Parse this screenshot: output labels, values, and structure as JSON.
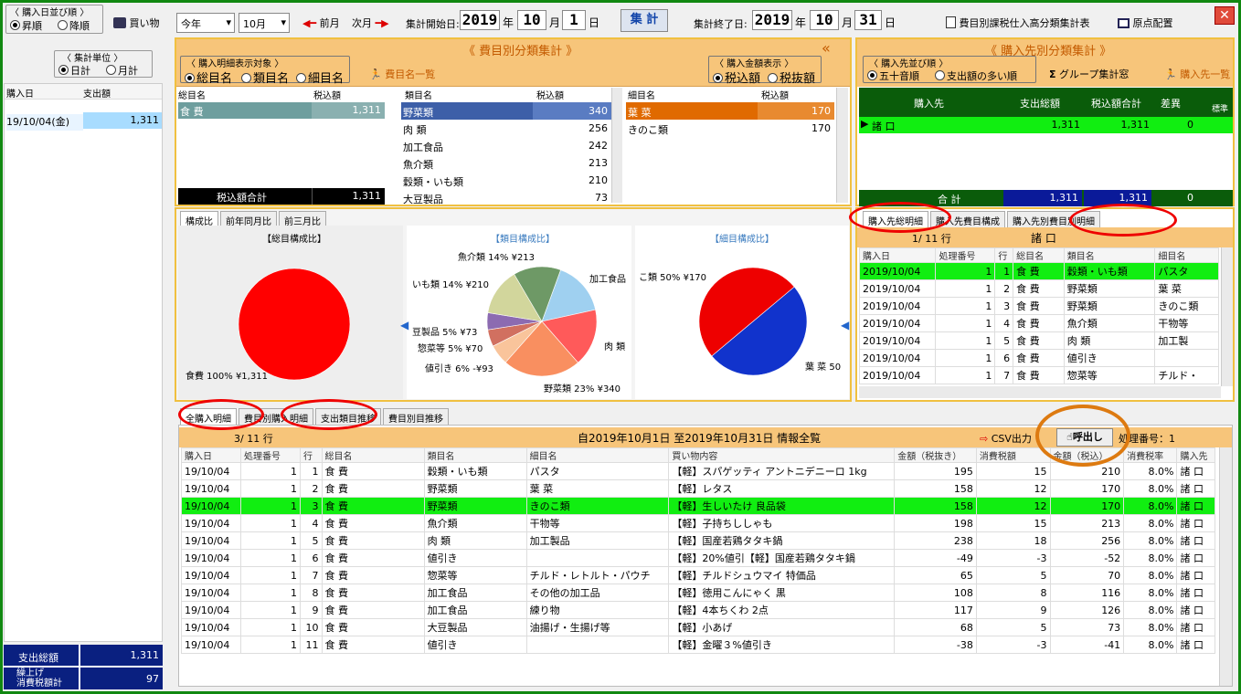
{
  "top": {
    "sort_group": "〈 購入日並び順 〉",
    "asc": "昇順",
    "desc": "降順",
    "shopping": "買い物",
    "year_sel": "今年",
    "month_sel": "10月",
    "prev": "前月",
    "next": "次月",
    "start_label": "集計開始日:",
    "start_y": "2019",
    "start_m": "10",
    "start_d": "1",
    "year_u": "年",
    "month_u": "月",
    "day_u": "日",
    "calc": "集 計",
    "end_label": "集計終了日:",
    "end_y": "2019",
    "end_m": "10",
    "end_d": "31",
    "report_btn": "費目別課税仕入高分類集計表",
    "gensetsu": "原点配置",
    "close": "✕"
  },
  "left": {
    "unit_group": "〈 集計単位 〉",
    "daily": "日計",
    "monthly": "月計",
    "col_date": "購入日",
    "col_amount": "支出額",
    "rows": [
      {
        "date": "19/10/04(金)",
        "amount": "1,311"
      }
    ],
    "total_label": "支出総額",
    "total_value": "1,311",
    "tax_label1": "繰上げ",
    "tax_label2": "消費税額計",
    "tax_value": "97"
  },
  "himoku": {
    "title": "《 費目別分類集計 》",
    "target_group": "〈 購入明細表示対象 〉",
    "opt1": "総目名",
    "opt2": "類目名",
    "opt3": "細目名",
    "list_btn": "費目名一覧",
    "amt_group": "〈 購入金額表示 〉",
    "incl": "税込額",
    "excl": "税抜額",
    "col_sou": "総目名",
    "col_tax": "税込額",
    "col_rui": "類目名",
    "col_sai": "細目名",
    "sou_rows": [
      {
        "name": "食 費",
        "value": "1,311"
      }
    ],
    "sou_total_label": "税込額合計",
    "sou_total": "1,311",
    "rui_rows": [
      {
        "name": "野菜類",
        "value": "340"
      },
      {
        "name": "肉 類",
        "value": "256"
      },
      {
        "name": "加工食品",
        "value": "242"
      },
      {
        "name": "魚介類",
        "value": "213"
      },
      {
        "name": "穀類・いも類",
        "value": "210"
      },
      {
        "name": "大豆製品",
        "value": "73"
      }
    ],
    "sai_rows": [
      {
        "name": "葉 菜",
        "value": "170"
      },
      {
        "name": "きのこ類",
        "value": "170"
      }
    ]
  },
  "pie": {
    "tabs": [
      "構成比",
      "前年同月比",
      "前三月比"
    ],
    "sou_title": "【総目構成比】",
    "rui_title": "【類目構成比】",
    "sai_title": "【細目構成比】",
    "sou_label": "食費 100% ¥1,311",
    "rui_labels": [
      "魚介類 14% ¥213",
      "加工食品",
      "肉 類",
      "野菜類 23% ¥340",
      "値引き 6% -¥93",
      "惣菜等 5% ¥70",
      "豆製品 5% ¥73",
      "いも類 14% ¥210"
    ],
    "sai_labels": [
      "こ類 50% ¥170",
      "葉 菜 50"
    ]
  },
  "chart_data": [
    {
      "type": "pie",
      "title": "【総目構成比】",
      "categories": [
        "食費"
      ],
      "values": [
        100
      ],
      "colors": [
        "#ff0000"
      ]
    },
    {
      "type": "pie",
      "title": "【類目構成比】",
      "categories": [
        "加工食品",
        "肉類",
        "野菜類",
        "値引き",
        "惣菜等",
        "豆製品",
        "穀類・いも類",
        "魚介類"
      ],
      "values": [
        16,
        17,
        23,
        6,
        5,
        5,
        14,
        14
      ],
      "colors": [
        "#9fd0f0",
        "#ff5a5a",
        "#f98f60",
        "#f9c49b",
        "#d17060",
        "#8c6bb1",
        "#d2d69c",
        "#6e9966"
      ]
    },
    {
      "type": "pie",
      "title": "【細目構成比】",
      "categories": [
        "葉菜",
        "きのこ類"
      ],
      "values": [
        50,
        50
      ],
      "colors": [
        "#1133cc",
        "#ee0000"
      ]
    }
  ],
  "shop": {
    "title": "《 購入先別分類集計 》",
    "sort_group": "〈 購入先並び順 〉",
    "opt1": "五十音順",
    "opt2": "支出額の多い順",
    "group_btn": "グループ集計窓",
    "list_btn": "購入先一覧",
    "cols": [
      "購入先",
      "支出総額",
      "税込額合計",
      "差異",
      "標準"
    ],
    "rows": [
      {
        "name": "諸 口",
        "total": "1,311",
        "taxin": "1,311",
        "diff": "0"
      }
    ],
    "sum_label": "合 計",
    "sum_total": "1,311",
    "sum_taxin": "1,311",
    "sum_diff": "0"
  },
  "detail_right": {
    "tabs": [
      "購入先総明細",
      "購入先費目構成",
      "購入先別費目別明細"
    ],
    "count": "1/ 11 行",
    "shop_name": "諸 口",
    "cols": [
      "購入日",
      "処理番号",
      "行",
      "総目名",
      "類目名",
      "細目名"
    ],
    "rows": [
      [
        "2019/10/04",
        "1",
        "1",
        "食 費",
        "穀類・いも類",
        "パスタ"
      ],
      [
        "2019/10/04",
        "1",
        "2",
        "食 費",
        "野菜類",
        "葉 菜"
      ],
      [
        "2019/10/04",
        "1",
        "3",
        "食 費",
        "野菜類",
        "きのこ類"
      ],
      [
        "2019/10/04",
        "1",
        "4",
        "食 費",
        "魚介類",
        "干物等"
      ],
      [
        "2019/10/04",
        "1",
        "5",
        "食 費",
        "肉 類",
        "加工製"
      ],
      [
        "2019/10/04",
        "1",
        "6",
        "食 費",
        "値引き",
        ""
      ],
      [
        "2019/10/04",
        "1",
        "7",
        "食 費",
        "惣菜等",
        "チルド・"
      ]
    ]
  },
  "bottom": {
    "tabs": [
      "全購入明細",
      "費目別購入明細",
      "支出類目推移",
      "費目別目推移"
    ],
    "count": "3/ 11 行",
    "title": "自2019年10月1日 至2019年10月31日 情報全覧",
    "csv": "CSV出力",
    "call": "呼出し",
    "proc_no": "処理番号：1",
    "cols": [
      "購入日",
      "処理番号",
      "行",
      "総目名",
      "類目名",
      "細目名",
      "買い物内容",
      "金額（税抜き）",
      "消費税額",
      "金額（税込）",
      "消費税率",
      "購入先"
    ],
    "rows": [
      [
        "19/10/04",
        "1",
        "1",
        "食 費",
        "穀類・いも類",
        "パスタ",
        "【軽】スパゲッティ アントニデニーロ 1kg",
        "195",
        "15",
        "210",
        "8.0%",
        "諸 口"
      ],
      [
        "19/10/04",
        "1",
        "2",
        "食 費",
        "野菜類",
        "葉 菜",
        "【軽】レタス",
        "158",
        "12",
        "170",
        "8.0%",
        "諸 口"
      ],
      [
        "19/10/04",
        "1",
        "3",
        "食 費",
        "野菜類",
        "きのこ類",
        "【軽】生しいたけ 良品袋",
        "158",
        "12",
        "170",
        "8.0%",
        "諸 口"
      ],
      [
        "19/10/04",
        "1",
        "4",
        "食 費",
        "魚介類",
        "干物等",
        "【軽】子持ちししゃも",
        "198",
        "15",
        "213",
        "8.0%",
        "諸 口"
      ],
      [
        "19/10/04",
        "1",
        "5",
        "食 費",
        "肉 類",
        "加工製品",
        "【軽】国産若鶏タタキ鍋",
        "238",
        "18",
        "256",
        "8.0%",
        "諸 口"
      ],
      [
        "19/10/04",
        "1",
        "6",
        "食 費",
        "値引き",
        "",
        "【軽】20%値引【軽】国産若鶏タタキ鍋",
        "-49",
        "-3",
        "-52",
        "8.0%",
        "諸 口"
      ],
      [
        "19/10/04",
        "1",
        "7",
        "食 費",
        "惣菜等",
        "チルド・レトルト・パウチ",
        "【軽】チルドシュウマイ 特価品",
        "65",
        "5",
        "70",
        "8.0%",
        "諸 口"
      ],
      [
        "19/10/04",
        "1",
        "8",
        "食 費",
        "加工食品",
        "その他の加工品",
        "【軽】徳用こんにゃく 黒",
        "108",
        "8",
        "116",
        "8.0%",
        "諸 口"
      ],
      [
        "19/10/04",
        "1",
        "9",
        "食 費",
        "加工食品",
        "練り物",
        "【軽】4本ちくわ 2点",
        "117",
        "9",
        "126",
        "8.0%",
        "諸 口"
      ],
      [
        "19/10/04",
        "1",
        "10",
        "食 費",
        "大豆製品",
        "油揚げ・生揚げ等",
        "【軽】小あげ",
        "68",
        "5",
        "73",
        "8.0%",
        "諸 口"
      ],
      [
        "19/10/04",
        "1",
        "11",
        "食 費",
        "値引き",
        "",
        "【軽】金曜３%値引き",
        "-38",
        "-3",
        "-41",
        "8.0%",
        "諸 口"
      ]
    ]
  }
}
